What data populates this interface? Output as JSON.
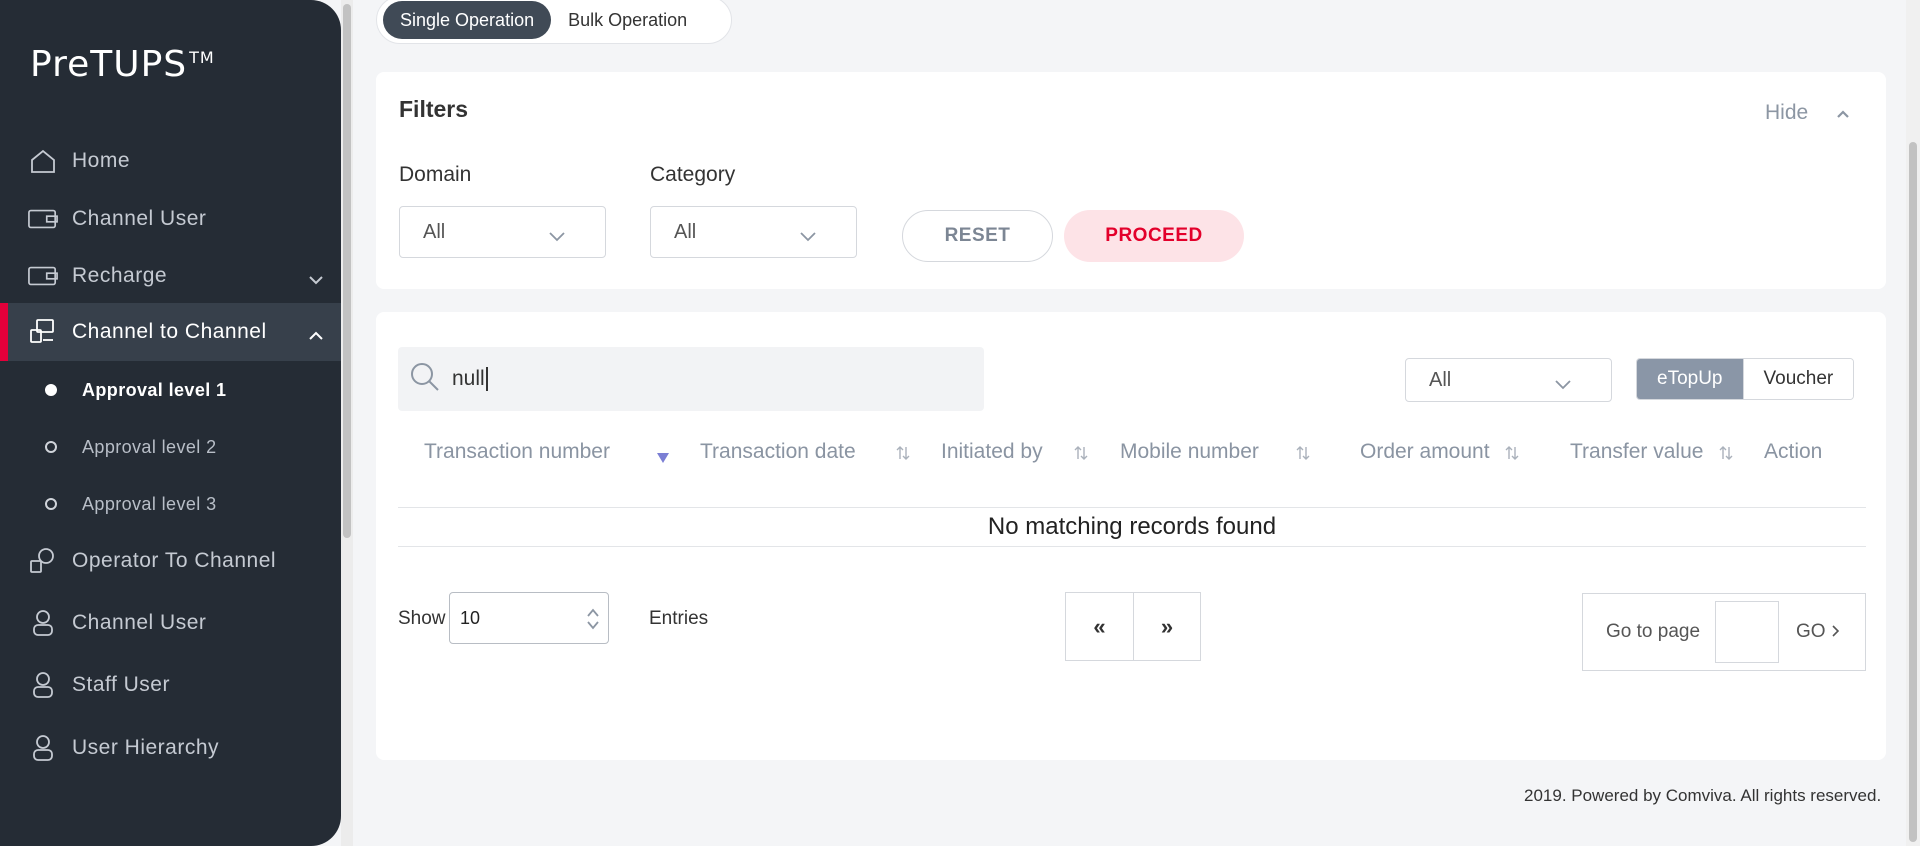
{
  "brand": {
    "name": "PreTUPS",
    "tm": "TM"
  },
  "sidebar": {
    "items": [
      {
        "label": "Home",
        "icon": "home-icon"
      },
      {
        "label": "Channel User",
        "icon": "wallet-icon"
      },
      {
        "label": "Recharge",
        "icon": "wallet-icon"
      },
      {
        "label": "Channel to Channel",
        "icon": "transfer-icon"
      },
      {
        "label": "Operator To Channel",
        "icon": "transfer-icon"
      },
      {
        "label": "Channel User",
        "icon": "user-icon"
      },
      {
        "label": "Staff User",
        "icon": "user-icon"
      },
      {
        "label": "User Hierarchy",
        "icon": "user-icon"
      }
    ],
    "sub_items": [
      {
        "label": "Approval level 1"
      },
      {
        "label": "Approval level 2"
      },
      {
        "label": "Approval level 3"
      }
    ]
  },
  "op_toggle": {
    "single": "Single Operation",
    "bulk": "Bulk Operation"
  },
  "filters": {
    "title": "Filters",
    "hide_label": "Hide",
    "domain_label": "Domain",
    "domain_value": "All",
    "category_label": "Category",
    "category_value": "All",
    "reset_label": "RESET",
    "proceed_label": "PROCEED"
  },
  "table": {
    "search_value": "null",
    "type_select": "All",
    "seg_etopup": "eTopUp",
    "seg_voucher": "Voucher",
    "columns": [
      "Transaction number",
      "Transaction date",
      "Initiated by",
      "Mobile number",
      "Order amount",
      "Transfer value",
      "Action"
    ],
    "empty_message": "No matching records found",
    "show_label": "Show",
    "entries_value": "10",
    "entries_label": "Entries",
    "prev": "«",
    "next": "»",
    "goto_label": "Go to page",
    "go_label": "GO"
  },
  "footer": {
    "text": "2019. Powered by Comviva. All rights reserved."
  },
  "colors": {
    "sidebar_bg": "#252c35",
    "accent": "#e3003a",
    "proceed_bg": "#fde3e7"
  }
}
